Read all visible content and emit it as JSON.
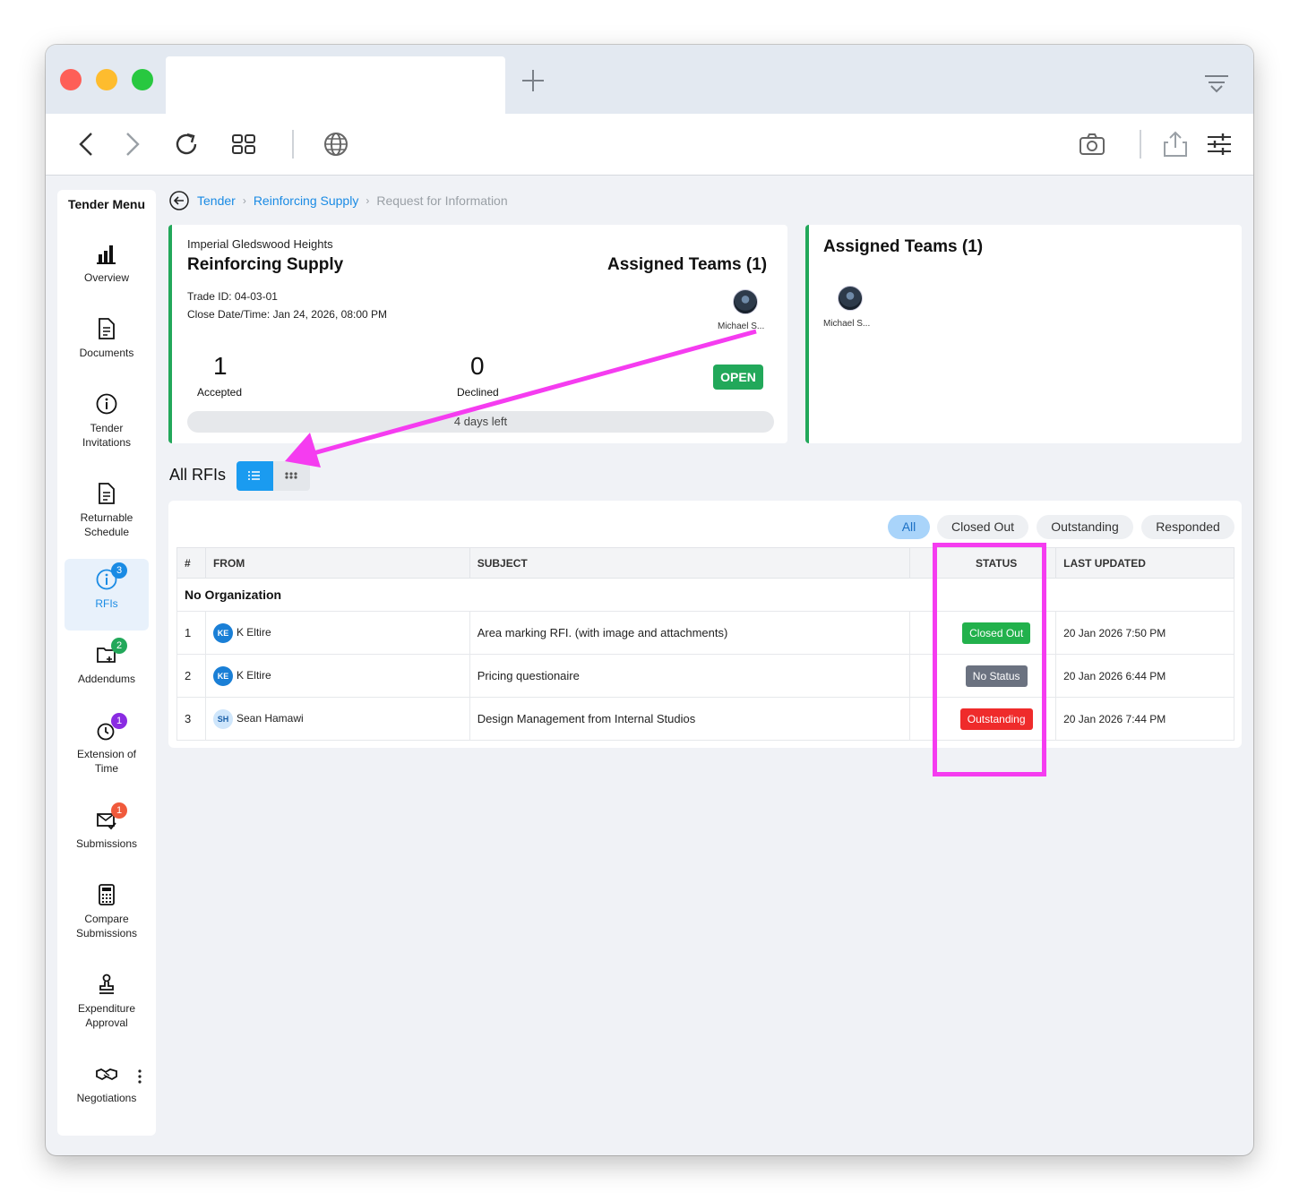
{
  "toolbar": {
    "icons": [
      "back-icon",
      "forward-icon",
      "reload-icon",
      "tabs-grid-icon",
      "globe-icon",
      "camera-icon",
      "share-icon",
      "settings-sliders-icon"
    ]
  },
  "sidebar": {
    "title": "Tender Menu",
    "items": [
      {
        "label": "Overview",
        "icon": "bar-chart-icon"
      },
      {
        "label": "Documents",
        "icon": "document-icon"
      },
      {
        "label": "Tender Invitations",
        "icon": "info-circle-icon"
      },
      {
        "label": "Returnable Schedule",
        "icon": "document-icon"
      },
      {
        "label": "RFIs",
        "icon": "info-circle-icon",
        "badge": "3",
        "badge_color": "#1a8be4",
        "active": true
      },
      {
        "label": "Addendums",
        "icon": "folder-plus-icon",
        "badge": "2",
        "badge_color": "#22a85a"
      },
      {
        "label": "Extension of Time",
        "icon": "clock-icon",
        "badge": "1",
        "badge_color": "#8a2be2"
      },
      {
        "label": "Submissions",
        "icon": "mail-check-icon",
        "badge": "1",
        "badge_color": "#f05a3c"
      },
      {
        "label": "Compare Submissions",
        "icon": "calculator-icon"
      },
      {
        "label": "Expenditure Approval",
        "icon": "stamp-icon"
      },
      {
        "label": "Negotiations",
        "icon": "handshake-icon"
      }
    ]
  },
  "breadcrumb": {
    "items": [
      "Tender",
      "Reinforcing Supply"
    ],
    "current": "Request for Information"
  },
  "summary": {
    "project": "Imperial Gledswood Heights",
    "trade_name": "Reinforcing Supply",
    "trade_id": "Trade ID: 04-03-01",
    "close_date": "Close Date/Time: Jan 24, 2026, 08:00 PM",
    "assigned_heading": "Assigned Teams (1)",
    "member_name": "Michael S...",
    "accepted_count": "1",
    "accepted_label": "Accepted",
    "declined_count": "0",
    "declined_label": "Declined",
    "status": "OPEN",
    "days_left": "4 days left"
  },
  "teams_card": {
    "heading": "Assigned Teams (1)",
    "member_name": "Michael S..."
  },
  "rfis": {
    "title": "All RFIs",
    "filters": [
      "All",
      "Closed Out",
      "Outstanding",
      "Responded"
    ],
    "active_filter": "All",
    "columns": [
      "#",
      "FROM",
      "SUBJECT",
      "",
      "STATUS",
      "LAST UPDATED"
    ],
    "group": "No Organization",
    "rows": [
      {
        "num": "1",
        "initials": "KE",
        "from": "K Eltire",
        "subject": "Area marking RFI. (with image and attachments)",
        "status": "Closed Out",
        "status_color": "#22b14c",
        "updated": "20 Jan 2026 7:50 PM"
      },
      {
        "num": "2",
        "initials": "KE",
        "from": "K Eltire",
        "subject": "Pricing questionaire",
        "status": "No Status",
        "status_color": "#6b7280",
        "updated": "20 Jan 2026 6:44 PM"
      },
      {
        "num": "3",
        "initials": "SH",
        "from": "Sean Hamawi",
        "subject": "Design Management from Internal Studios",
        "status": "Outstanding",
        "status_color": "#ef2b2b",
        "updated": "20 Jan 2026 7:44 PM"
      }
    ]
  },
  "colors": {
    "accent": "#1a8be4",
    "open_green": "#22a85a",
    "annotation": "#f53cf0"
  }
}
